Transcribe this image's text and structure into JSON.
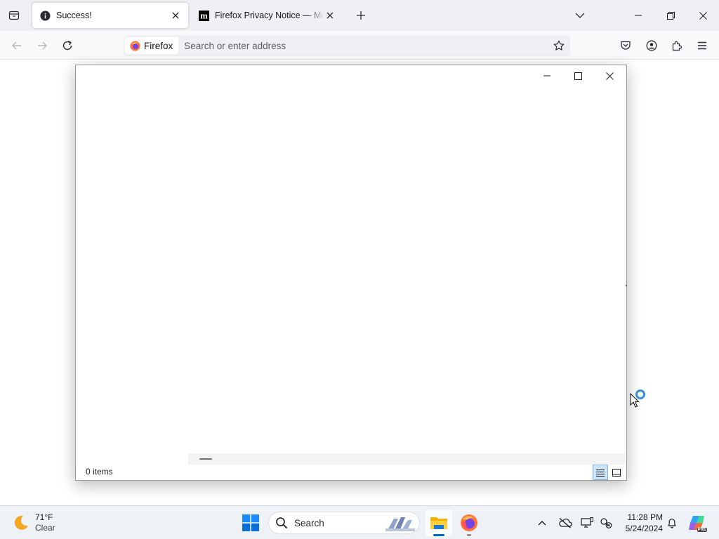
{
  "browser": {
    "tabs": [
      {
        "title": "Success!",
        "active": true,
        "icon": "info-icon"
      },
      {
        "title": "Firefox Privacy Notice — Mozilla",
        "active": false,
        "icon": "mozilla-m-icon"
      }
    ],
    "identity_label": "Firefox",
    "address_placeholder": "Search or enter address",
    "toolbar_icons": [
      "back-arrow-icon",
      "forward-arrow-icon",
      "reload-icon",
      "bookmark-star-icon",
      "pocket-icon",
      "account-icon",
      "extensions-icon",
      "hamburger-menu-icon"
    ]
  },
  "dialog": {
    "status_text": "0 items",
    "view_buttons": [
      "details-view-icon",
      "tiles-view-icon"
    ],
    "active_view": "details"
  },
  "taskbar": {
    "weather": {
      "temperature": "71°F",
      "condition": "Clear",
      "icon": "moon-icon"
    },
    "search_label": "Search",
    "pinned_apps": [
      "file-explorer-icon",
      "firefox-icon"
    ],
    "clock": {
      "time": "11:28 PM",
      "date": "5/24/2024"
    },
    "copilot_badge": "PRE"
  },
  "colors": {
    "tabstrip_bg": "#f0f0f4",
    "accent_blue": "#0067c0",
    "busy_ring": "#2f8fe5",
    "firefox_orange": "#ff7139"
  }
}
